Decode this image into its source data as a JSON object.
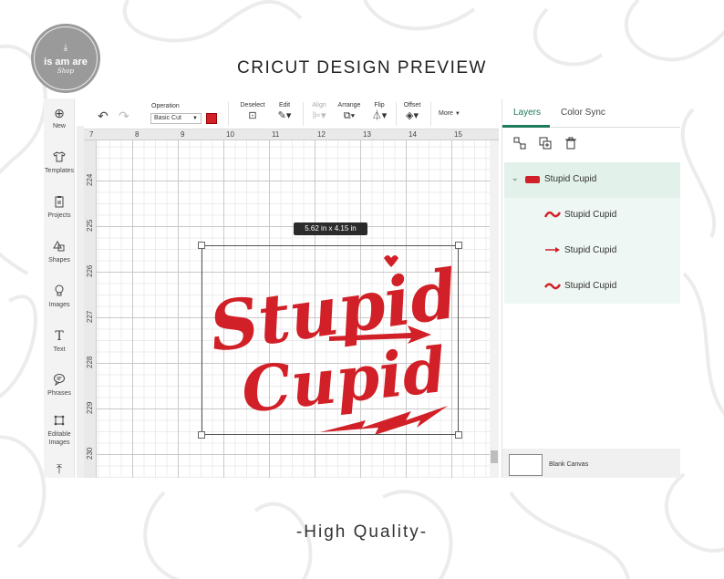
{
  "page": {
    "title": "CRICUT DESIGN PREVIEW",
    "footer": "-High Quality-"
  },
  "logo": {
    "name": "is am are",
    "sub": "Shop",
    "icon": "download-icon"
  },
  "left_nav": [
    {
      "label": "New",
      "icon": "plus-circle-icon"
    },
    {
      "label": "Templates",
      "icon": "tshirt-icon"
    },
    {
      "label": "Projects",
      "icon": "clipboard-icon"
    },
    {
      "label": "Shapes",
      "icon": "shapes-icon"
    },
    {
      "label": "Images",
      "icon": "lightbulb-icon"
    },
    {
      "label": "Text",
      "icon": "text-t-icon"
    },
    {
      "label": "Phrases",
      "icon": "speech-bubble-icon"
    },
    {
      "label": "Editable Images",
      "icon": "crop-icon"
    },
    {
      "label": "",
      "icon": "upload-icon"
    }
  ],
  "toolbar": {
    "operation_label": "Operation",
    "operation_value": "Basic Cut",
    "operation_color": "#d12027",
    "deselect": "Deselect",
    "edit": "Edit",
    "align": "Align",
    "arrange": "Arrange",
    "flip": "Flip",
    "offset": "Offset",
    "more": "More"
  },
  "ruler": {
    "top": [
      "7",
      "8",
      "9",
      "10",
      "11",
      "12",
      "13",
      "14",
      "15"
    ],
    "left": [
      "224",
      "225",
      "226",
      "227",
      "228",
      "229",
      "230"
    ]
  },
  "canvas": {
    "dimension": "5.62  in x 4.15  in",
    "design_color": "#d12027",
    "design_lines": [
      "Stupid",
      "Cupid"
    ]
  },
  "panel": {
    "tabs": [
      "Layers",
      "Color Sync"
    ],
    "active_tab": "Layers",
    "actions": [
      "group-icon",
      "duplicate-icon",
      "trash-icon"
    ],
    "group_name": "Stupid Cupid",
    "layers": [
      "Stupid Cupid",
      "Stupid Cupid",
      "Stupid Cupid"
    ],
    "blank_canvas": "Blank Canvas"
  },
  "colors": {
    "accent": "#1d7a5c",
    "design_red": "#d12027"
  }
}
